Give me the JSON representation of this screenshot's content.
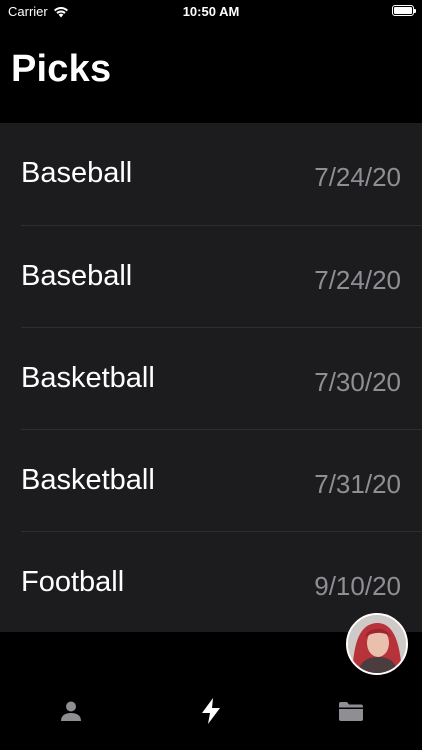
{
  "status_bar": {
    "carrier": "Carrier",
    "time": "10:50 AM",
    "battery_level": 1.0
  },
  "header": {
    "title": "Picks"
  },
  "picks": [
    {
      "sport": "Baseball",
      "date": "7/24/20"
    },
    {
      "sport": "Baseball",
      "date": "7/24/20"
    },
    {
      "sport": "Basketball",
      "date": "7/30/20"
    },
    {
      "sport": "Basketball",
      "date": "7/31/20"
    },
    {
      "sport": "Football",
      "date": "9/10/20"
    }
  ],
  "tab_bar": {
    "tabs": [
      {
        "icon": "person-icon",
        "selected": false
      },
      {
        "icon": "bolt-icon",
        "selected": true
      },
      {
        "icon": "folder-icon",
        "selected": false
      }
    ]
  },
  "colors": {
    "background": "#000000",
    "list_background": "#1c1c1e",
    "date_text": "#8e8e93",
    "tab_inactive": "#8e8e93",
    "tab_active": "#ffffff"
  }
}
